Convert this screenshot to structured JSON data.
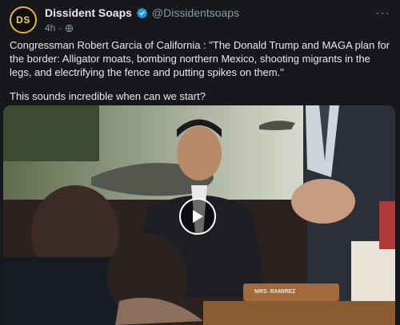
{
  "tweet": {
    "avatar_initials": "DS",
    "display_name": "Dissident Soaps",
    "handle": "@Dissidentsoaps",
    "time": "4h",
    "text_lines": [
      "Congressman Robert Garcia of California : \"The Donald Trump and MAGA plan for the border: Alligator moats, bombing northern Mexico, shooting migrants in the legs, and electrifying the fence and putting spikes on them.\"",
      "This sounds incredible when can we start?"
    ],
    "more_label": "···",
    "nameplate_label": "MRS. RAMIREZ"
  },
  "colors": {
    "background": "#16181c",
    "text": "#e7e9ea",
    "muted": "#8b98a5",
    "verified": "#1d9bf0",
    "avatar_ring": "#e1b53a"
  },
  "icons": [
    "verified-badge-icon",
    "globe-icon",
    "more-icon",
    "play-icon"
  ]
}
